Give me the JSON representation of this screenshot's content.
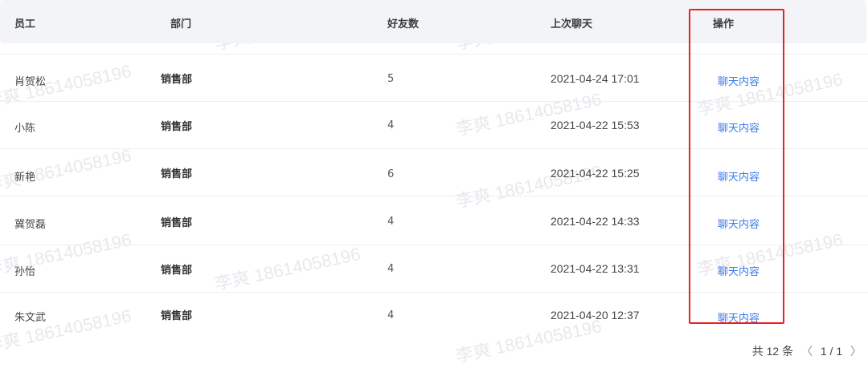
{
  "table": {
    "headers": {
      "employee": "员工",
      "department": "部门",
      "friends": "好友数",
      "last_chat": "上次聊天",
      "action": "操作"
    },
    "rows": [
      {
        "employee": "肖贺松",
        "department": "销售部",
        "friends": "5",
        "last_chat": "2021-04-24 17:01",
        "action": "聊天内容"
      },
      {
        "employee": "小陈",
        "department": "销售部",
        "friends": "4",
        "last_chat": "2021-04-22 15:53",
        "action": "聊天内容"
      },
      {
        "employee": "新艳",
        "department": "销售部",
        "friends": "6",
        "last_chat": "2021-04-22 15:25",
        "action": "聊天内容"
      },
      {
        "employee": "冀贺磊",
        "department": "销售部",
        "friends": "4",
        "last_chat": "2021-04-22 14:33",
        "action": "聊天内容"
      },
      {
        "employee": "孙怡",
        "department": "销售部",
        "friends": "4",
        "last_chat": "2021-04-22 13:31",
        "action": "聊天内容"
      },
      {
        "employee": "朱文武",
        "department": "销售部",
        "friends": "4",
        "last_chat": "2021-04-20 12:37",
        "action": "聊天内容"
      }
    ]
  },
  "pagination": {
    "total": "共 12 条",
    "prev": "〈",
    "page": "1 / 1",
    "next": "〉"
  },
  "colors": {
    "link": "#3a7be8",
    "highlight": "#ee1f1f",
    "header_bg": "#f3f4f7"
  },
  "watermark": "李爽 18614058196"
}
